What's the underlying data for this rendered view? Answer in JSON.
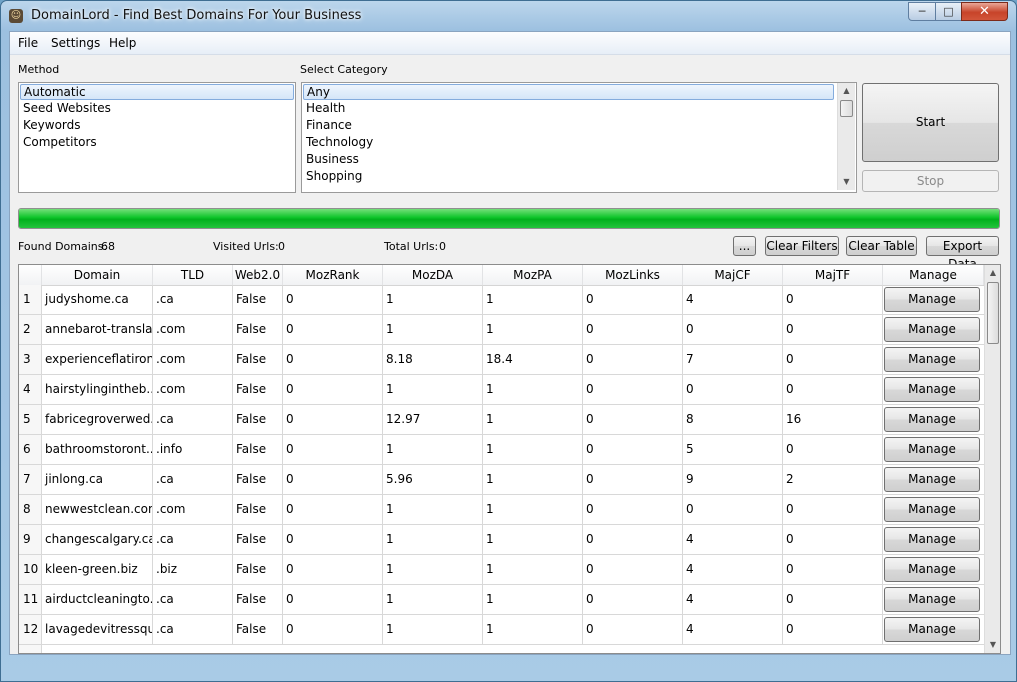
{
  "window": {
    "title": "DomainLord - Find Best Domains For Your Business",
    "minimize": "─",
    "maximize": "□",
    "close": "✕"
  },
  "menu": [
    "File",
    "Settings",
    "Help"
  ],
  "method": {
    "label": "Method",
    "items": [
      "Automatic",
      "Seed Websites",
      "Keywords",
      "Competitors"
    ],
    "selected": "Automatic"
  },
  "category": {
    "label": "Select Category",
    "items": [
      "Any",
      "Health",
      "Finance",
      "Technology",
      "Business",
      "Shopping"
    ]
  },
  "buttons": {
    "start": "Start",
    "stop": "Stop",
    "more": "...",
    "clear_filters": "Clear Filters",
    "clear_table": "Clear Table",
    "export_data": "Export Data"
  },
  "progress": {
    "value": 1.0,
    "color": "#0ec42a"
  },
  "stats": {
    "found_label": "Found Domains:",
    "found_value": "68",
    "visited_label": "Visited Urls:",
    "visited_value": "0",
    "total_label": "Total Urls:",
    "total_value": "0"
  },
  "table": {
    "columns": [
      "Domain",
      "TLD",
      "Web2.0",
      "MozRank",
      "MozDA",
      "MozPA",
      "MozLinks",
      "MajCF",
      "MajTF",
      "Manage"
    ],
    "manage_label": "Manage",
    "rows": [
      {
        "idx": "1",
        "domain": "judyshome.ca",
        "tld": ".ca",
        "web2": "False",
        "mozrank": "0",
        "mozda": "1",
        "mozpa": "1",
        "mozlinks": "0",
        "majcf": "4",
        "majtf": "0"
      },
      {
        "idx": "2",
        "domain": "annebarot-transla...",
        "tld": ".com",
        "web2": "False",
        "mozrank": "0",
        "mozda": "1",
        "mozpa": "1",
        "mozlinks": "0",
        "majcf": "0",
        "majtf": "0"
      },
      {
        "idx": "3",
        "domain": "experienceflatiron...",
        "tld": ".com",
        "web2": "False",
        "mozrank": "0",
        "mozda": "8.18",
        "mozpa": "18.4",
        "mozlinks": "0",
        "majcf": "7",
        "majtf": "0"
      },
      {
        "idx": "4",
        "domain": "hairstylingintheb...",
        "tld": ".com",
        "web2": "False",
        "mozrank": "0",
        "mozda": "1",
        "mozpa": "1",
        "mozlinks": "0",
        "majcf": "0",
        "majtf": "0"
      },
      {
        "idx": "5",
        "domain": "fabricegroverwed...",
        "tld": ".ca",
        "web2": "False",
        "mozrank": "0",
        "mozda": "12.97",
        "mozpa": "1",
        "mozlinks": "0",
        "majcf": "8",
        "majtf": "16"
      },
      {
        "idx": "6",
        "domain": "bathroomstoront...",
        "tld": ".info",
        "web2": "False",
        "mozrank": "0",
        "mozda": "1",
        "mozpa": "1",
        "mozlinks": "0",
        "majcf": "5",
        "majtf": "0"
      },
      {
        "idx": "7",
        "domain": "jinlong.ca",
        "tld": ".ca",
        "web2": "False",
        "mozrank": "0",
        "mozda": "5.96",
        "mozpa": "1",
        "mozlinks": "0",
        "majcf": "9",
        "majtf": "2"
      },
      {
        "idx": "8",
        "domain": "newwestclean.com",
        "tld": ".com",
        "web2": "False",
        "mozrank": "0",
        "mozda": "1",
        "mozpa": "1",
        "mozlinks": "0",
        "majcf": "0",
        "majtf": "0"
      },
      {
        "idx": "9",
        "domain": "changescalgary.ca",
        "tld": ".ca",
        "web2": "False",
        "mozrank": "0",
        "mozda": "1",
        "mozpa": "1",
        "mozlinks": "0",
        "majcf": "4",
        "majtf": "0"
      },
      {
        "idx": "10",
        "domain": "kleen-green.biz",
        "tld": ".biz",
        "web2": "False",
        "mozrank": "0",
        "mozda": "1",
        "mozpa": "1",
        "mozlinks": "0",
        "majcf": "4",
        "majtf": "0"
      },
      {
        "idx": "11",
        "domain": "airductcleaningto...",
        "tld": ".ca",
        "web2": "False",
        "mozrank": "0",
        "mozda": "1",
        "mozpa": "1",
        "mozlinks": "0",
        "majcf": "4",
        "majtf": "0"
      },
      {
        "idx": "12",
        "domain": "lavagedevitressqu...",
        "tld": ".ca",
        "web2": "False",
        "mozrank": "0",
        "mozda": "1",
        "mozpa": "1",
        "mozlinks": "0",
        "majcf": "4",
        "majtf": "0"
      }
    ]
  }
}
